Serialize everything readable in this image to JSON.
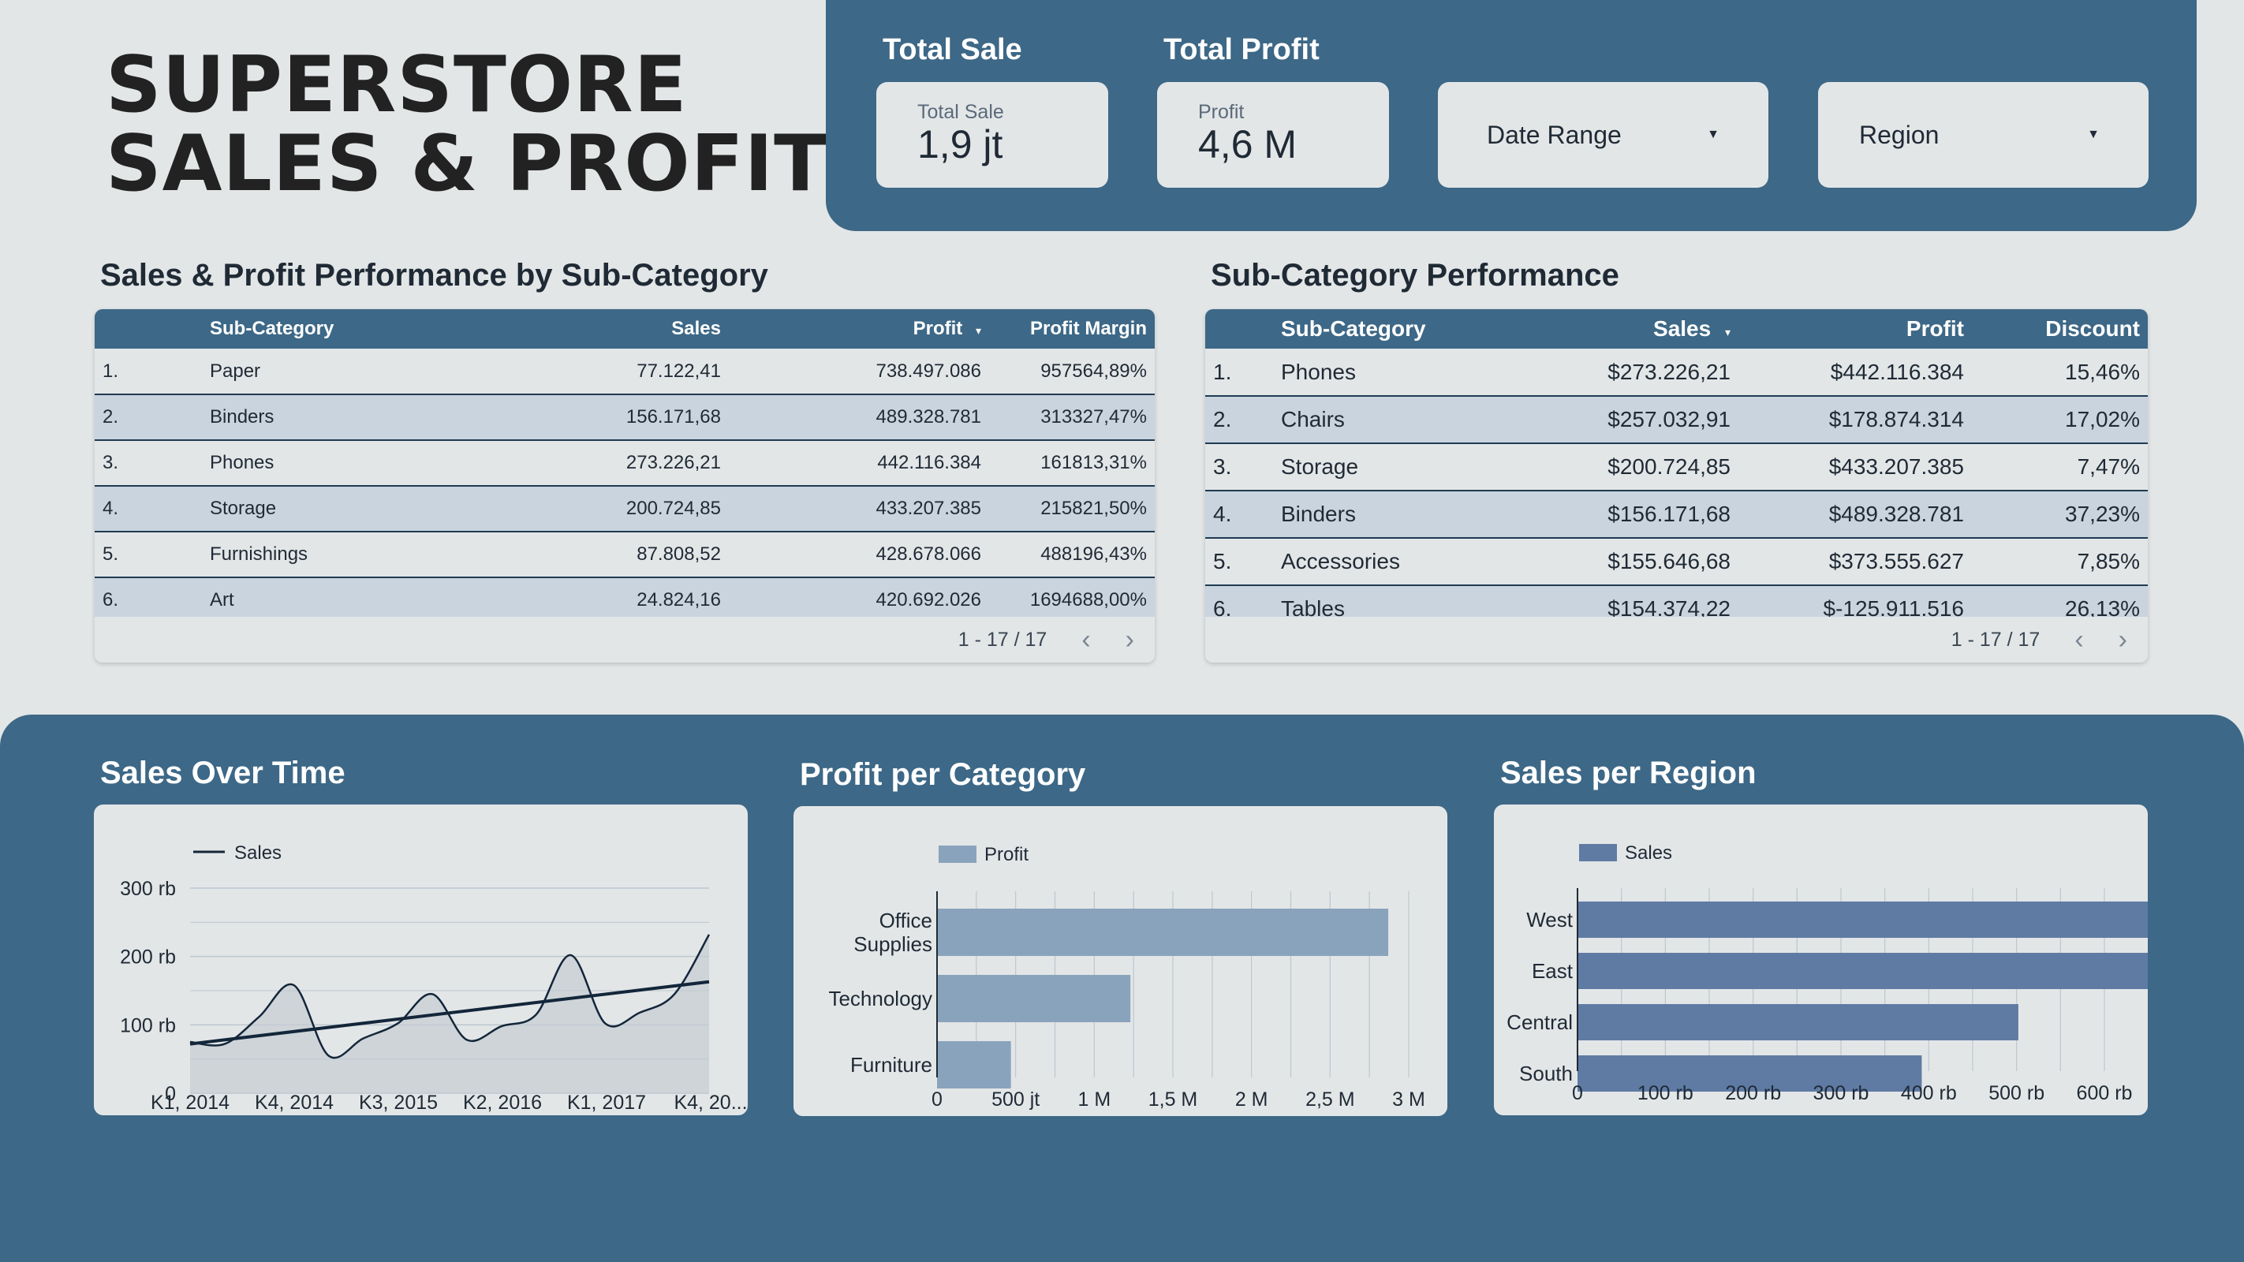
{
  "header": {
    "title_line1": "SUPERSTORE",
    "title_line2": "SALES & PROFIT"
  },
  "kpis": {
    "total_sale": {
      "title": "Total Sale",
      "label": "Total Sale",
      "value": "1,9 jt"
    },
    "total_profit": {
      "title": "Total Profit",
      "label": "Profit",
      "value": "4,6 M"
    }
  },
  "filters": {
    "date_range": "Date Range",
    "region": "Region"
  },
  "table1": {
    "title": "Sales & Profit Performance by Sub-Category",
    "columns": [
      "",
      "Sub-Category",
      "Sales",
      "Profit",
      "Profit Margin"
    ],
    "sort_indicator": "▾",
    "rows": [
      [
        "1.",
        "Paper",
        "77.122,41",
        "738.497.086",
        "957564,89%"
      ],
      [
        "2.",
        "Binders",
        "156.171,68",
        "489.328.781",
        "313327,47%"
      ],
      [
        "3.",
        "Phones",
        "273.226,21",
        "442.116.384",
        "161813,31%"
      ],
      [
        "4.",
        "Storage",
        "200.724,85",
        "433.207.385",
        "215821,50%"
      ],
      [
        "5.",
        "Furnishings",
        "87.808,52",
        "428.678.066",
        "488196,43%"
      ],
      [
        "6.",
        "Art",
        "24.824,16",
        "420.692.026",
        "1694688,00%"
      ]
    ],
    "pagination": "1 - 17 / 17"
  },
  "table2": {
    "title": "Sub-Category Performance",
    "columns": [
      "",
      "Sub-Category",
      "Sales",
      "Profit",
      "Discount"
    ],
    "sort_indicator": "▾",
    "rows": [
      [
        "1.",
        "Phones",
        "$273.226,21",
        "$442.116.384",
        "15,46%"
      ],
      [
        "2.",
        "Chairs",
        "$257.032,91",
        "$178.874.314",
        "17,02%"
      ],
      [
        "3.",
        "Storage",
        "$200.724,85",
        "$433.207.385",
        "7,47%"
      ],
      [
        "4.",
        "Binders",
        "$156.171,68",
        "$489.328.781",
        "37,23%"
      ],
      [
        "5.",
        "Accessories",
        "$155.646,68",
        "$373.555.627",
        "7,85%"
      ],
      [
        "6.",
        "Tables",
        "$154.374,22",
        "$-125.911.516",
        "26,13%"
      ]
    ],
    "pagination": "1 - 17 / 17"
  },
  "pager_icons": {
    "prev": "chevron-left-icon",
    "next": "chevron-right-icon",
    "prev_glyph": "‹",
    "next_glyph": "›"
  },
  "charts_titles": {
    "sales_over_time": "Sales Over Time",
    "profit_per_category": "Profit per Category",
    "sales_per_region": "Sales per Region"
  },
  "colors": {
    "panel": "#3d6887",
    "line": "#13263a",
    "profit_bar": "#8aa3bd",
    "region_bar": "#5f7ba4",
    "grid": "#bcc7cf"
  },
  "chart_data": [
    {
      "type": "line",
      "legend": [
        "Sales"
      ],
      "x_ticks": [
        "K1, 2014",
        "K4, 2014",
        "K3, 2015",
        "K2, 2016",
        "K1, 2017",
        "K4, 20..."
      ],
      "y_ticks": [
        "0",
        "100 rb",
        "200 rb",
        "300 rb"
      ],
      "ylim": [
        0,
        300000
      ],
      "series": [
        {
          "name": "Sales",
          "values": [
            75000,
            72000,
            112000,
            158000,
            55000,
            80000,
            102000,
            145000,
            78000,
            98000,
            115000,
            202000,
            102000,
            118000,
            145000,
            232000
          ]
        }
      ],
      "trendline": [
        72000,
        163000
      ]
    },
    {
      "type": "bar",
      "orientation": "horizontal",
      "legend": [
        "Profit"
      ],
      "categories": [
        [
          "Office",
          "Supplies"
        ],
        [
          "Technology"
        ],
        [
          "Furniture"
        ]
      ],
      "values": [
        2870000000,
        1230000000,
        470000000
      ],
      "x_ticks": [
        "0",
        "500 jt",
        "1 M",
        "1,5 M",
        "2 M",
        "2,5 M",
        "3 M"
      ],
      "xlim": [
        0,
        3000000000
      ]
    },
    {
      "type": "bar",
      "orientation": "horizontal",
      "legend": [
        "Sales"
      ],
      "categories": [
        "West",
        "East",
        "Central",
        "South"
      ],
      "values": [
        725000,
        677000,
        502000,
        392000
      ],
      "x_ticks": [
        "0",
        "100 rb",
        "200 rb",
        "300 rb",
        "400 rb",
        "500 rb",
        "600 rb"
      ],
      "xlim": [
        0,
        600000
      ]
    }
  ]
}
